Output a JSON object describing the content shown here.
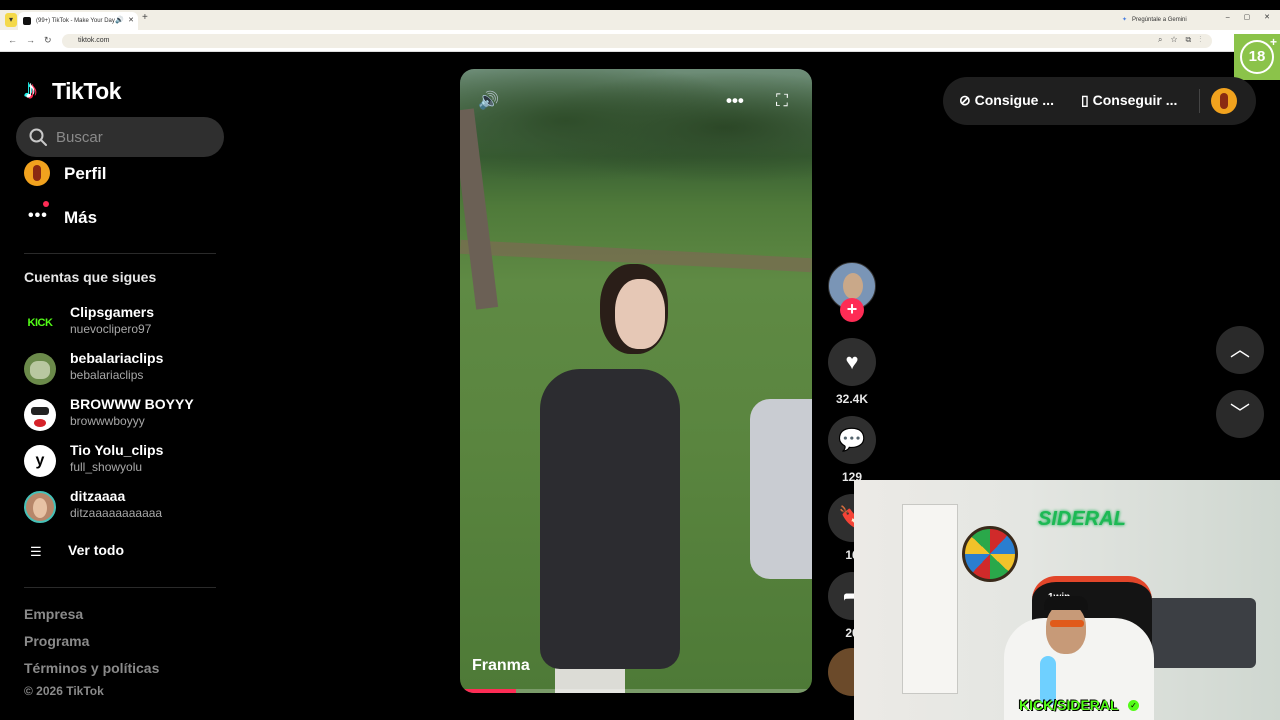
{
  "browser": {
    "tab_title": "(99+) TikTok - Make Your Day",
    "new_tab": "+",
    "gemini_label": "Pregúntale a Gemini",
    "url": "tiktok.com",
    "age_badge": "18",
    "age_plus": "+"
  },
  "sidebar": {
    "logo_text": "TikTok",
    "search_placeholder": "Buscar",
    "profile_label": "Perfil",
    "more_label": "Más",
    "following_title": "Cuentas que sigues",
    "accounts": [
      {
        "name": "Clipsgamers",
        "handle": "nuevoclipero97",
        "avatar_text": "KICK"
      },
      {
        "name": "bebalariaclips",
        "handle": "bebalariaclips"
      },
      {
        "name": "BROWWW BOYYY",
        "handle": "browwwboyyy"
      },
      {
        "name": "Tio Yolu_clips",
        "handle": "full_showyolu",
        "avatar_text": "y"
      },
      {
        "name": "ditzaaaa",
        "handle": "ditzaaaaaaaaaaa"
      }
    ],
    "see_all_label": "Ver todo",
    "footer": {
      "links": [
        "Empresa",
        "Programa",
        "Términos y políticas"
      ],
      "copyright": "© 2026 TikTok"
    }
  },
  "video": {
    "author_overlay": "Franma",
    "progress": 0.16
  },
  "actions": {
    "likes": "32.4K",
    "comments": "129",
    "saves": "16",
    "shares": "20"
  },
  "topbar": {
    "coins_label": "Consigue ...",
    "app_label": "Conseguir ..."
  },
  "webcam": {
    "sign_text": "SIDERAL",
    "chair_text": "1win",
    "overlay_text": "KICK/SIDERAL"
  },
  "colors": {
    "accent": "#fe2c55",
    "kick_green": "#53fc18",
    "background": "#000000"
  }
}
